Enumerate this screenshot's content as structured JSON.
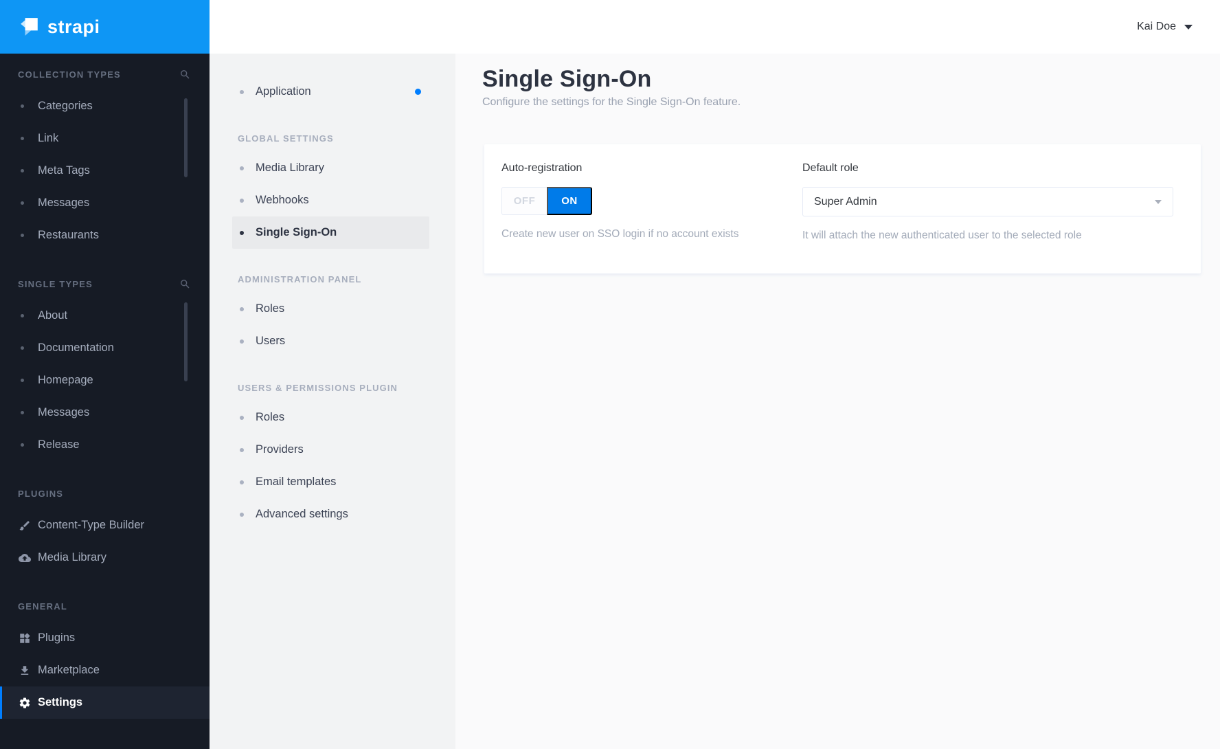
{
  "brand": {
    "name": "strapi"
  },
  "header": {
    "user_name": "Kai Doe"
  },
  "colors": {
    "brand_blue": "#0e96f5",
    "accent_blue": "#007eff",
    "toggle_on_blue": "#007be9"
  },
  "sidebar": {
    "sections": [
      {
        "title": "COLLECTION TYPES",
        "search": true,
        "items": [
          {
            "label": "Categories"
          },
          {
            "label": "Link"
          },
          {
            "label": "Meta Tags"
          },
          {
            "label": "Messages"
          },
          {
            "label": "Restaurants"
          }
        ]
      },
      {
        "title": "SINGLE TYPES",
        "search": true,
        "items": [
          {
            "label": "About"
          },
          {
            "label": "Documentation"
          },
          {
            "label": "Homepage"
          },
          {
            "label": "Messages"
          },
          {
            "label": "Release"
          }
        ]
      },
      {
        "title": "PLUGINS",
        "items": [
          {
            "label": "Content-Type Builder",
            "icon": "brush-icon"
          },
          {
            "label": "Media Library",
            "icon": "cloud-upload-icon"
          }
        ]
      },
      {
        "title": "GENERAL",
        "items": [
          {
            "label": "Plugins",
            "icon": "cubes-icon"
          },
          {
            "label": "Marketplace",
            "icon": "download-icon"
          },
          {
            "label": "Settings",
            "icon": "gear-icon",
            "active": true
          }
        ]
      }
    ]
  },
  "settings_nav": {
    "groups": [
      {
        "items": [
          {
            "label": "Application",
            "dot": true
          }
        ]
      },
      {
        "title": "GLOBAL SETTINGS",
        "items": [
          {
            "label": "Media Library"
          },
          {
            "label": "Webhooks"
          },
          {
            "label": "Single Sign-On",
            "active": true
          }
        ]
      },
      {
        "title": "ADMINISTRATION PANEL",
        "items": [
          {
            "label": "Roles"
          },
          {
            "label": "Users"
          }
        ]
      },
      {
        "title": "USERS & PERMISSIONS PLUGIN",
        "items": [
          {
            "label": "Roles"
          },
          {
            "label": "Providers"
          },
          {
            "label": "Email templates"
          },
          {
            "label": "Advanced settings"
          }
        ]
      }
    ]
  },
  "main": {
    "title": "Single Sign-On",
    "subtitle": "Configure the settings for the Single Sign-On feature.",
    "form": {
      "auto_registration": {
        "label": "Auto-registration",
        "options": [
          "OFF",
          "ON"
        ],
        "selected": "ON",
        "helper": "Create new user on SSO login if no account exists"
      },
      "default_role": {
        "label": "Default role",
        "value": "Super Admin",
        "helper": "It will attach the new authenticated user to the selected role"
      }
    }
  }
}
